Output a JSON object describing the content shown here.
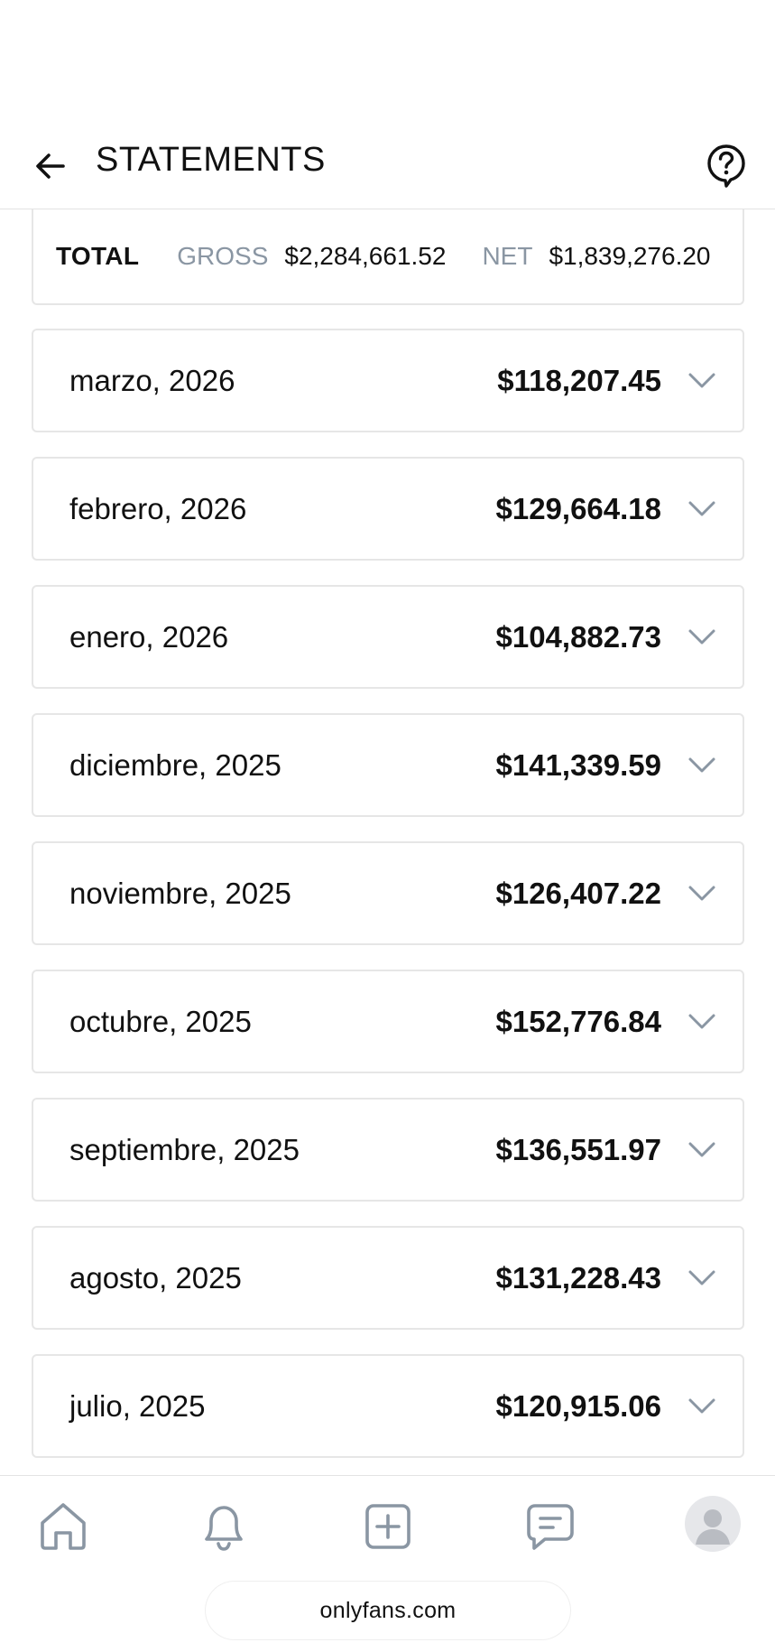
{
  "header": {
    "title": "STATEMENTS",
    "back_icon": "arrow-left-icon",
    "help_icon": "help-circle-icon"
  },
  "total": {
    "label": "TOTAL",
    "gross_label": "GROSS",
    "gross_value": "$2,284,661.52",
    "net_label": "NET",
    "net_value": "$1,839,276.20"
  },
  "months": [
    {
      "label": "marzo, 2026",
      "amount": "$118,207.45"
    },
    {
      "label": "febrero, 2026",
      "amount": "$129,664.18"
    },
    {
      "label": "enero, 2026",
      "amount": "$104,882.73"
    },
    {
      "label": "diciembre, 2025",
      "amount": "$141,339.59"
    },
    {
      "label": "noviembre, 2025",
      "amount": "$126,407.22"
    },
    {
      "label": "octubre, 2025",
      "amount": "$152,776.84"
    },
    {
      "label": "septiembre, 2025",
      "amount": "$136,551.97"
    },
    {
      "label": "agosto, 2025",
      "amount": "$131,228.43"
    },
    {
      "label": "julio, 2025",
      "amount": "$120,915.06"
    }
  ],
  "nav": {
    "items": [
      "home-icon",
      "bell-icon",
      "plus-square-icon",
      "message-icon",
      "avatar"
    ]
  },
  "browser": {
    "url": "onlyfans.com"
  },
  "colors": {
    "muted": "#8a96a3",
    "border": "#e6e6e6",
    "icon": "#8a96a3",
    "text": "#111111"
  }
}
